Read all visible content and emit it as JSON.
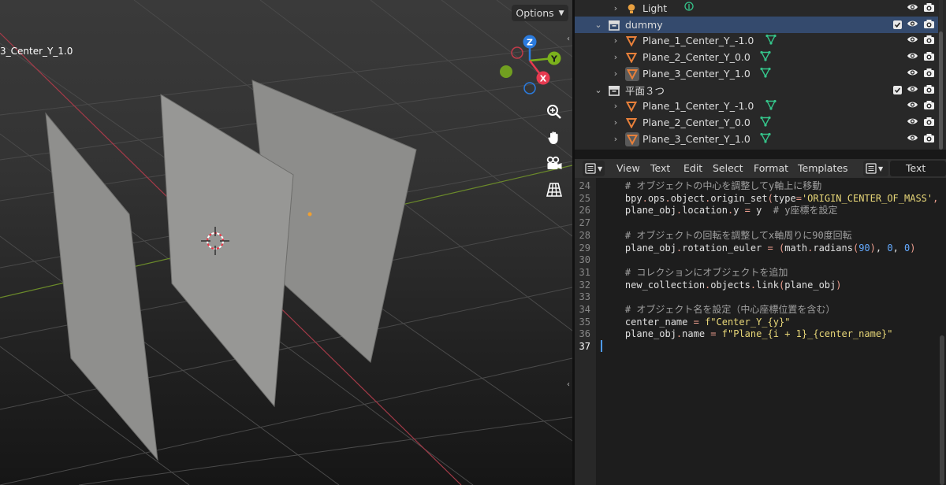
{
  "viewport": {
    "object_label": "3_Center_Y_1.0",
    "options_label": "Options",
    "gizmo": {
      "z": "Z",
      "y": "Y",
      "x": "X"
    }
  },
  "outliner": {
    "rows": [
      {
        "label": "Light",
        "type": "light",
        "indent": 1,
        "expand": "›",
        "selected": false,
        "visible": true
      },
      {
        "label": "dummy",
        "type": "collection",
        "indent": 0,
        "expand": "⌄",
        "selected": true,
        "checkbox": true
      },
      {
        "label": "Plane_1_Center_Y_-1.0",
        "type": "mesh",
        "indent": 1,
        "expand": "›",
        "selected": false
      },
      {
        "label": "Plane_2_Center_Y_0.0",
        "type": "mesh",
        "indent": 1,
        "expand": "›",
        "selected": false
      },
      {
        "label": "Plane_3_Center_Y_1.0",
        "type": "mesh-active",
        "indent": 1,
        "expand": "›",
        "selected": false
      },
      {
        "label": "平面３つ",
        "type": "collection",
        "indent": 0,
        "expand": "⌄",
        "selected": false,
        "checkbox": true
      },
      {
        "label": "Plane_1_Center_Y_-1.0",
        "type": "mesh",
        "indent": 1,
        "expand": "›",
        "selected": false
      },
      {
        "label": "Plane_2_Center_Y_0.0",
        "type": "mesh",
        "indent": 1,
        "expand": "›",
        "selected": false
      },
      {
        "label": "Plane_3_Center_Y_1.0",
        "type": "mesh-active",
        "indent": 1,
        "expand": "›",
        "selected": false
      }
    ]
  },
  "text_editor": {
    "menu": [
      "View",
      "Text",
      "Edit",
      "Select",
      "Format",
      "Templates"
    ],
    "text_name": "Text",
    "current_line": 37,
    "lines": [
      {
        "n": 24,
        "segs": [
          [
            "c-com",
            "    # オブジェクトの中心を調整してy軸上に移動"
          ]
        ]
      },
      {
        "n": 25,
        "segs": [
          [
            "",
            "    bpy"
          ],
          [
            "c-op",
            "."
          ],
          [
            "",
            "ops"
          ],
          [
            "c-op",
            "."
          ],
          [
            "",
            "object"
          ],
          [
            "c-op",
            "."
          ],
          [
            "",
            "origin_set"
          ],
          [
            "c-op",
            "("
          ],
          [
            "",
            "type"
          ],
          [
            "c-op",
            "="
          ],
          [
            "c-str",
            "'ORIGIN_CENTER_OF_MASS'"
          ],
          [
            "c-op",
            ","
          ]
        ]
      },
      {
        "n": 26,
        "segs": [
          [
            "",
            "    plane_obj"
          ],
          [
            "c-op",
            "."
          ],
          [
            "",
            "location"
          ],
          [
            "c-op",
            "."
          ],
          [
            "",
            "y "
          ],
          [
            "c-op",
            "="
          ],
          [
            "",
            " y  "
          ],
          [
            "c-com",
            "# y座標を設定"
          ]
        ]
      },
      {
        "n": 27,
        "segs": []
      },
      {
        "n": 28,
        "segs": [
          [
            "c-com",
            "    # オブジェクトの回転を調整してx軸周りに90度回転"
          ]
        ]
      },
      {
        "n": 29,
        "segs": [
          [
            "",
            "    plane_obj"
          ],
          [
            "c-op",
            "."
          ],
          [
            "",
            "rotation_euler "
          ],
          [
            "c-op",
            "="
          ],
          [
            "",
            " "
          ],
          [
            "c-op",
            "("
          ],
          [
            "",
            "math"
          ],
          [
            "c-op",
            "."
          ],
          [
            "",
            "radians"
          ],
          [
            "c-op",
            "("
          ],
          [
            "c-num",
            "90"
          ],
          [
            "c-op",
            ")"
          ],
          [
            "",
            ", "
          ],
          [
            "c-num",
            "0"
          ],
          [
            "",
            ", "
          ],
          [
            "c-num",
            "0"
          ],
          [
            "c-op",
            ")"
          ]
        ]
      },
      {
        "n": 30,
        "segs": []
      },
      {
        "n": 31,
        "segs": [
          [
            "c-com",
            "    # コレクションにオブジェクトを追加"
          ]
        ]
      },
      {
        "n": 32,
        "segs": [
          [
            "",
            "    new_collection"
          ],
          [
            "c-op",
            "."
          ],
          [
            "",
            "objects"
          ],
          [
            "c-op",
            "."
          ],
          [
            "",
            "link"
          ],
          [
            "c-op",
            "("
          ],
          [
            "",
            "plane_obj"
          ],
          [
            "c-op",
            ")"
          ]
        ]
      },
      {
        "n": 33,
        "segs": []
      },
      {
        "n": 34,
        "segs": [
          [
            "c-com",
            "    # オブジェクト名を設定（中心座標位置を含む）"
          ]
        ]
      },
      {
        "n": 35,
        "segs": [
          [
            "",
            "    center_name "
          ],
          [
            "c-op",
            "="
          ],
          [
            "",
            " "
          ],
          [
            "c-str",
            "f\"Center_Y_{y}\""
          ]
        ]
      },
      {
        "n": 36,
        "segs": [
          [
            "",
            "    plane_obj"
          ],
          [
            "c-op",
            "."
          ],
          [
            "",
            "name "
          ],
          [
            "c-op",
            "="
          ],
          [
            "",
            " "
          ],
          [
            "c-str",
            "f\"Plane_{i + 1}_{center_name}\""
          ]
        ]
      },
      {
        "n": 37,
        "segs": []
      }
    ]
  },
  "colors": {
    "selection": "#344a6d",
    "mesh_icon": "#e8803a",
    "data_icon": "#35c48a",
    "axis_x": "#e63a50",
    "axis_y": "#7bb11c",
    "axis_z": "#2b7bde"
  }
}
